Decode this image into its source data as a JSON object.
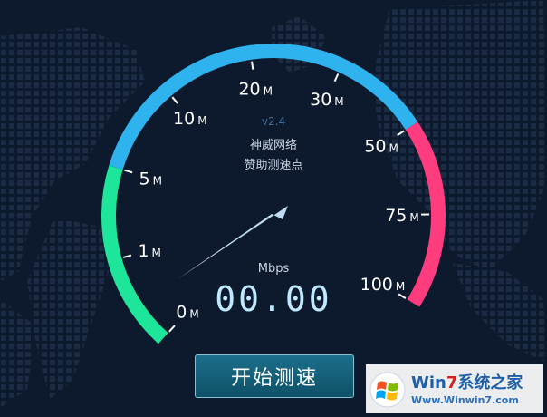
{
  "gauge": {
    "version": "v2.4",
    "sponsor_line1": "神威网络",
    "sponsor_line2": "赞助测速点",
    "unit": "Mbps",
    "reading": "00.00",
    "speed_mbps": 0,
    "scale": [
      {
        "num": "0",
        "unit": "M"
      },
      {
        "num": "1",
        "unit": "M"
      },
      {
        "num": "5",
        "unit": "M"
      },
      {
        "num": "10",
        "unit": "M"
      },
      {
        "num": "20",
        "unit": "M"
      },
      {
        "num": "30",
        "unit": "M"
      },
      {
        "num": "50",
        "unit": "M"
      },
      {
        "num": "75",
        "unit": "M"
      },
      {
        "num": "100",
        "unit": "M"
      }
    ],
    "colors": {
      "low": "#1de59a",
      "mid": "#2eb3ee",
      "high": "#ff3c7e",
      "needle": "#c9e6fb",
      "digits": "#bfe9ff",
      "background": "#0d1a2e"
    }
  },
  "actions": {
    "start_label": "开始测速"
  },
  "watermark": {
    "title_part1": "Win",
    "title_part2": "7",
    "title_part3": "系统之家",
    "site": "Www.Winwin7.com"
  }
}
